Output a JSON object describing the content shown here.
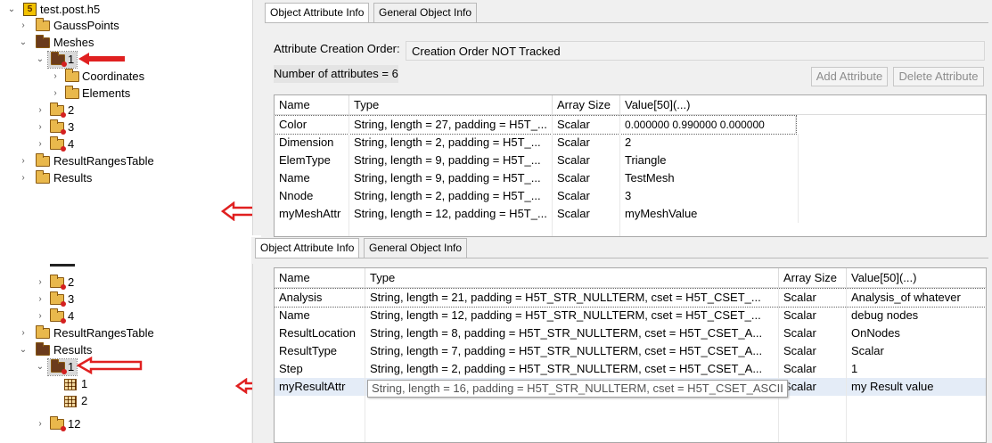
{
  "tree_top": {
    "root": "test.post.h5",
    "items": [
      "GaussPoints",
      "Meshes",
      "1",
      "Coordinates",
      "Elements",
      "2",
      "3",
      "4",
      "ResultRangesTable",
      "Results"
    ]
  },
  "tree_bottom": {
    "items": [
      "2",
      "3",
      "4",
      "ResultRangesTable",
      "Results",
      "1",
      "1",
      "2",
      "12"
    ]
  },
  "panel_top": {
    "tabs": [
      "Object Attribute Info",
      "General Object Info"
    ],
    "creation_order_label": "Attribute Creation Order:",
    "creation_order_value": "Creation Order NOT Tracked",
    "num_attributes": "Number of attributes = 6",
    "add_button": "Add Attribute",
    "delete_button": "Delete Attribute",
    "columns": [
      "Name",
      "Type",
      "Array Size",
      "Value[50](...)"
    ],
    "rows": [
      [
        "Color",
        "String, length = 27, padding = H5T_...",
        "Scalar",
        "0.000000 0.990000 0.000000"
      ],
      [
        "Dimension",
        "String, length = 2, padding = H5T_...",
        "Scalar",
        "2"
      ],
      [
        "ElemType",
        "String, length = 9, padding = H5T_...",
        "Scalar",
        "Triangle"
      ],
      [
        "Name",
        "String, length = 9, padding = H5T_...",
        "Scalar",
        "TestMesh"
      ],
      [
        "Nnode",
        "String, length = 2, padding = H5T_...",
        "Scalar",
        "3"
      ],
      [
        "myMeshAttr",
        "String, length = 12, padding = H5T_...",
        "Scalar",
        "myMeshValue"
      ]
    ]
  },
  "panel_bottom": {
    "tabs": [
      "Object Attribute Info",
      "General Object Info"
    ],
    "columns": [
      "Name",
      "Type",
      "Array Size",
      "Value[50](...)"
    ],
    "rows": [
      [
        "Analysis",
        "String, length = 21, padding = H5T_STR_NULLTERM, cset = H5T_CSET_...",
        "Scalar",
        "Analysis_of whatever"
      ],
      [
        "Name",
        "String, length = 12, padding = H5T_STR_NULLTERM, cset = H5T_CSET_...",
        "Scalar",
        "debug nodes"
      ],
      [
        "ResultLocation",
        "String, length = 8, padding = H5T_STR_NULLTERM, cset = H5T_CSET_A...",
        "Scalar",
        "OnNodes"
      ],
      [
        "ResultType",
        "String, length = 7, padding = H5T_STR_NULLTERM, cset = H5T_CSET_A...",
        "Scalar",
        "Scalar"
      ],
      [
        "Step",
        "String, length = 2, padding = H5T_STR_NULLTERM, cset = H5T_CSET_A...",
        "Scalar",
        "1"
      ],
      [
        "myResultAttr",
        "",
        "Scalar",
        "my Result value"
      ]
    ],
    "tooltip": "String, length = 16, padding = H5T_STR_NULLTERM, cset = H5T_CSET_ASCII"
  },
  "colors": {
    "arrow_red": "#e02020",
    "selection_row": "#e4ecf7",
    "folder": "#e9b84c"
  }
}
